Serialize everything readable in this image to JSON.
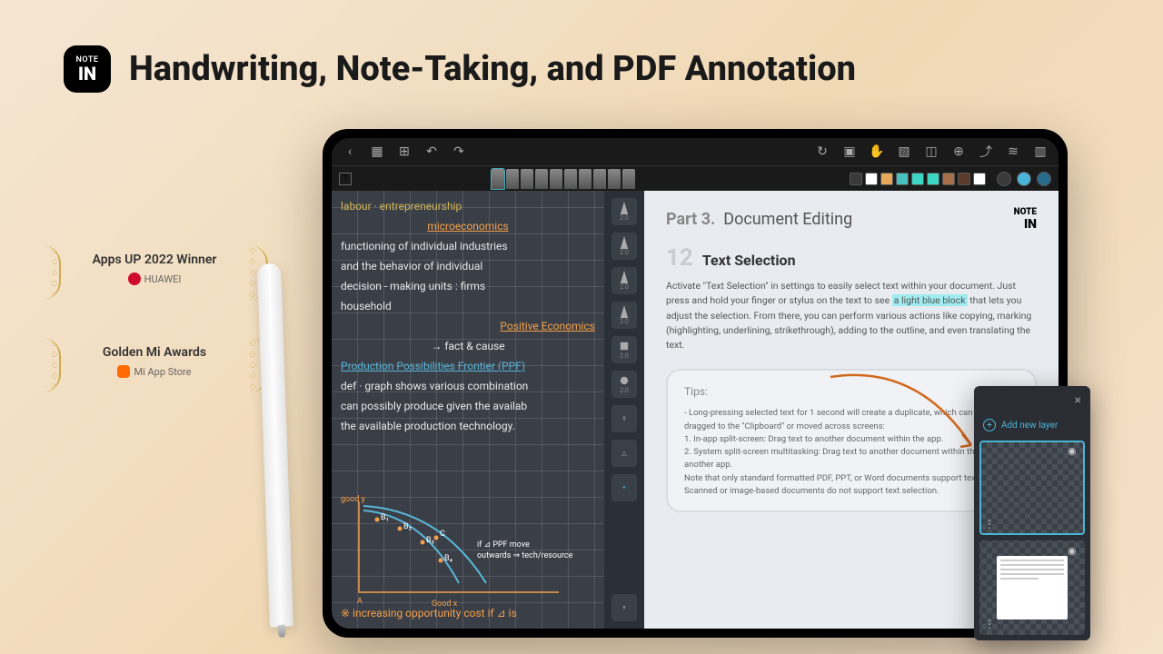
{
  "header": {
    "logo_top": "NOTE",
    "logo_bottom": "IN",
    "title": "Handwriting, Note-Taking, and PDF Annotation"
  },
  "awards": [
    {
      "title": "Apps UP 2022 Winner",
      "brand": "HUAWEI",
      "brand_icon": "huawei"
    },
    {
      "title": "Golden Mi Awards",
      "brand": "Mi App Store",
      "brand_icon": "mi"
    }
  ],
  "topbar_icons": [
    "back",
    "grid",
    "apps",
    "undo",
    "redo",
    "sync",
    "inbox",
    "pan",
    "image",
    "crop",
    "add",
    "share",
    "layers",
    "panels"
  ],
  "pen_sidebar": [
    "2.0",
    "2.0",
    "2.0",
    "2.0",
    "2.0",
    "2.0"
  ],
  "pen_sidebar_extra": [
    "eraser",
    "shape",
    "plus"
  ],
  "palette": [
    "#3a3a3a",
    "#ffffff",
    "#e8a85a",
    "#4abfbf",
    "#4abfbf",
    "#3dd6c4",
    "#a8704a",
    "#5a3a2a",
    "#ffffff"
  ],
  "handwriting": {
    "l1": "labour · entrepreneurship",
    "l2": "microeconomics",
    "l3": "functioning of individual industries",
    "l4": "and the behavior of individual",
    "l5": "decision - making units : firms",
    "l6": "household",
    "l7": "Positive Economics",
    "l8": "→ fact & cause",
    "l9": "Production Possibilities Frontier (PPF)",
    "l10": "def · graph shows various combination",
    "l11": "can possibly produce given the availab",
    "l12": "the available production technology.",
    "good_y": "good y",
    "good_x": "Good x",
    "ppf_note": "if ⊿ PPF move outwards ⇒ tech / resource",
    "bottom": "※ increasing opportunity cost   if ⊿ is"
  },
  "document": {
    "part_label": "Part",
    "part_num": "3.",
    "part_title": "Document Editing",
    "logo": "NOTE IN",
    "sec_num": "12",
    "sec_title": "Text Selection",
    "body_pre": "Activate \"Text Selection\" in settings to easily select text within your document. Just press and hold your finger or stylus on the text to see ",
    "body_hl": "a light blue block",
    "body_post": " that lets you adjust the selection. From there, you can perform various actions like copying, marking (highlighting, underlining, strikethrough), adding to the outline, and even translating the text.",
    "tips_title": "Tips:",
    "tip1": "- Long-pressing selected text for 1 second will create a duplicate, which can be directly dragged to the \"Clipboard\" or moved across screens:",
    "tip2": "1. In-app split-screen: Drag text to another document within the app.",
    "tip3": "2. System split-screen multitasking: Drag text to another document within the app or to another app.",
    "tip4": "Note that only standard formatted PDF, PPT, or Word documents support text selection. Scanned or image-based documents do not support text selection."
  },
  "layers": {
    "close": "×",
    "add_label": "Add new layer",
    "eye": "◉",
    "dots": "⋮"
  }
}
